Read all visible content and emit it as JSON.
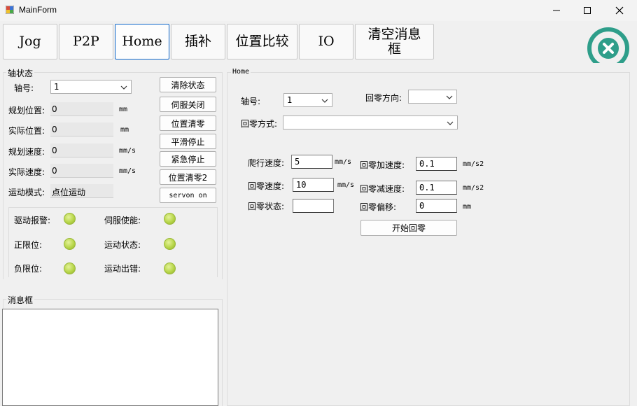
{
  "window": {
    "title": "MainForm",
    "icon": "winforms-app-icon",
    "controls": {
      "minimize": "minimize-icon",
      "maximize": "maximize-icon",
      "close": "close-icon"
    }
  },
  "nav": {
    "jog": "Jog",
    "p2p": "P2P",
    "home": "Home",
    "interp": "插补",
    "compare": "位置比较",
    "io": "IO",
    "clear_msg_line1": "清空消息",
    "clear_msg_line2": "框",
    "active": "Home"
  },
  "axis_status": {
    "legend": "轴状态",
    "axis_label": "轴号:",
    "axis_value": "1",
    "planned_pos_label": "规划位置:",
    "planned_pos_value": "0",
    "planned_pos_unit": "mm",
    "actual_pos_label": "实际位置:",
    "actual_pos_value": "0",
    "actual_pos_unit": "mm",
    "planned_vel_label": "规划速度:",
    "planned_vel_value": "0",
    "planned_vel_unit": "mm/s",
    "actual_vel_label": "实际速度:",
    "actual_vel_value": "0",
    "actual_vel_unit": "mm/s",
    "mode_label": "运动模式:",
    "mode_value": "点位运动",
    "buttons": {
      "clear_status": "清除状态",
      "servo_off": "伺服关闭",
      "pos_zero": "位置清零",
      "smooth_stop": "平滑停止",
      "emergency_stop": "紧急停止",
      "pos_zero2": "位置清零2",
      "servo_on": "servon on"
    },
    "indicators": {
      "drive_alarm": "驱动报警:",
      "servo_enable": "伺服使能:",
      "pos_limit": "正限位:",
      "motion_status": "运动状态:",
      "neg_limit": "负限位:",
      "motion_error": "运动出错:"
    },
    "led_color": "#b8d64a"
  },
  "message_box": {
    "legend": "消息框",
    "content": ""
  },
  "home_panel": {
    "legend": "Home",
    "axis_label": "轴号:",
    "axis_value": "1",
    "direction_label": "回零方向:",
    "direction_value": "",
    "mode_label": "回零方式:",
    "mode_value": "",
    "crawl_speed_label": "爬行速度:",
    "crawl_speed_value": "5",
    "crawl_speed_unit": "mm/s",
    "home_speed_label": "回零速度:",
    "home_speed_value": "10",
    "home_speed_unit": "mm/s",
    "home_status_label": "回零状态:",
    "home_status_value": "",
    "home_acc_label": "回零加速度:",
    "home_acc_value": "0.1",
    "home_acc_unit": "mm/s2",
    "home_dec_label": "回零减速度:",
    "home_dec_value": "0.1",
    "home_dec_unit": "mm/s2",
    "home_offset_label": "回零偏移:",
    "home_offset_value": "0",
    "home_offset_unit": "mm",
    "start_button": "开始回零"
  },
  "logo": {
    "icon": "close-circle-logo-icon",
    "color": "#2e9e8a"
  }
}
